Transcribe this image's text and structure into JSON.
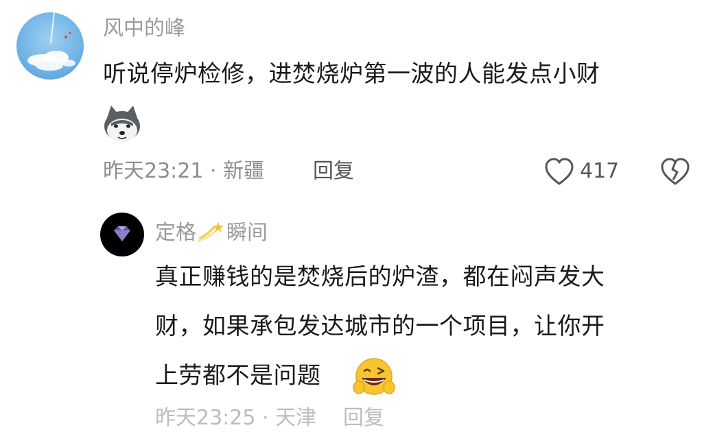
{
  "comment1": {
    "username": "风中的峰",
    "text": "听说停炉检修，进焚烧炉第一波的人能发点小财",
    "time_location": "昨天23:21 · 新疆",
    "reply_label": "回复",
    "like_count": "417"
  },
  "comment2": {
    "username_part1": "定格",
    "username_part2": "瞬间",
    "line1": "真正赚钱的是焚烧后的炉渣，都在闷声发大",
    "line2": "财，如果承包发达城市的一个项目，让你开",
    "line3": "上劳都不是问题",
    "meta_cut": "昨天23:25 · 天津",
    "reply_cut": "回复"
  },
  "icons": {
    "avatar1": "sky-clouds-avatar",
    "avatar2": "diamond-avatar",
    "sticker": "husky-dog-emoji",
    "like": "heart-outline-icon",
    "dislike": "broken-heart-icon",
    "emoji": "grinning-wink-emoji",
    "star": "shooting-star-emoji"
  }
}
